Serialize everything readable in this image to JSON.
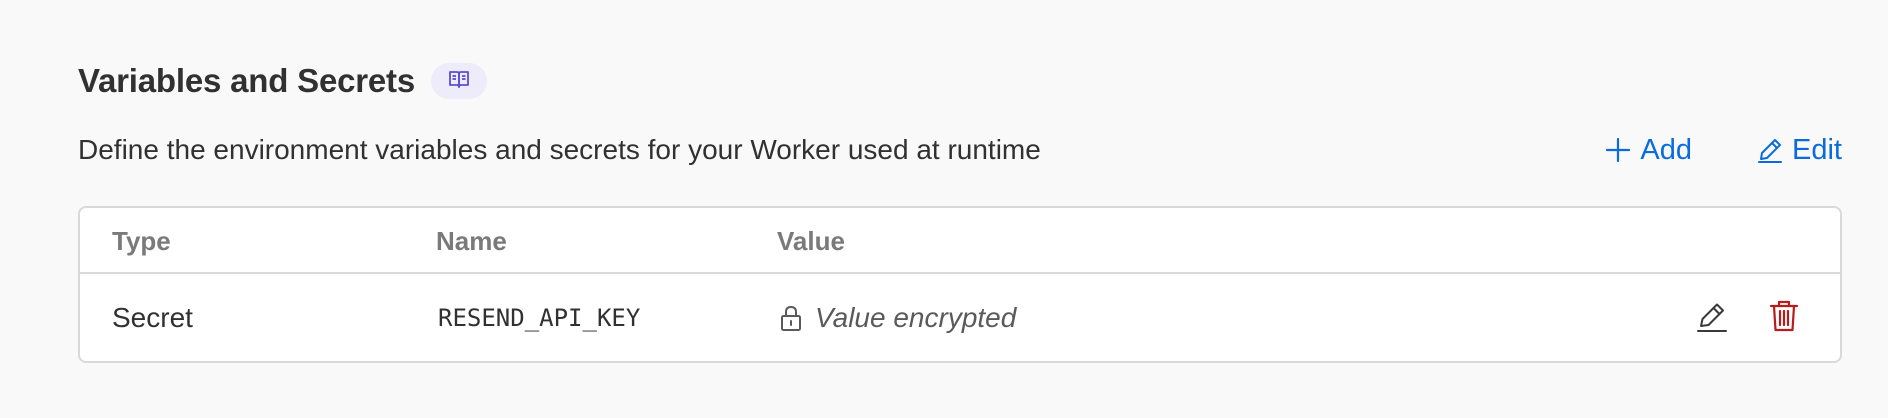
{
  "header": {
    "title": "Variables and Secrets",
    "docs_icon": "book-open-icon",
    "description": "Define the environment variables and secrets for your Worker used at runtime"
  },
  "actions": {
    "add_label": "Add",
    "add_icon": "plus-icon",
    "edit_label": "Edit",
    "edit_icon": "pencil-icon"
  },
  "table": {
    "columns": [
      "Type",
      "Name",
      "Value"
    ],
    "rows": [
      {
        "type": "Secret",
        "name": "RESEND_API_KEY",
        "value": "Value encrypted",
        "value_icon": "lock-icon",
        "row_actions": [
          "pencil-icon",
          "trash-icon"
        ]
      }
    ]
  },
  "colors": {
    "accent": "#0a6cdc",
    "danger": "#b81c1c",
    "badge_bg": "#eeebfb",
    "border": "#d9d9d9"
  }
}
